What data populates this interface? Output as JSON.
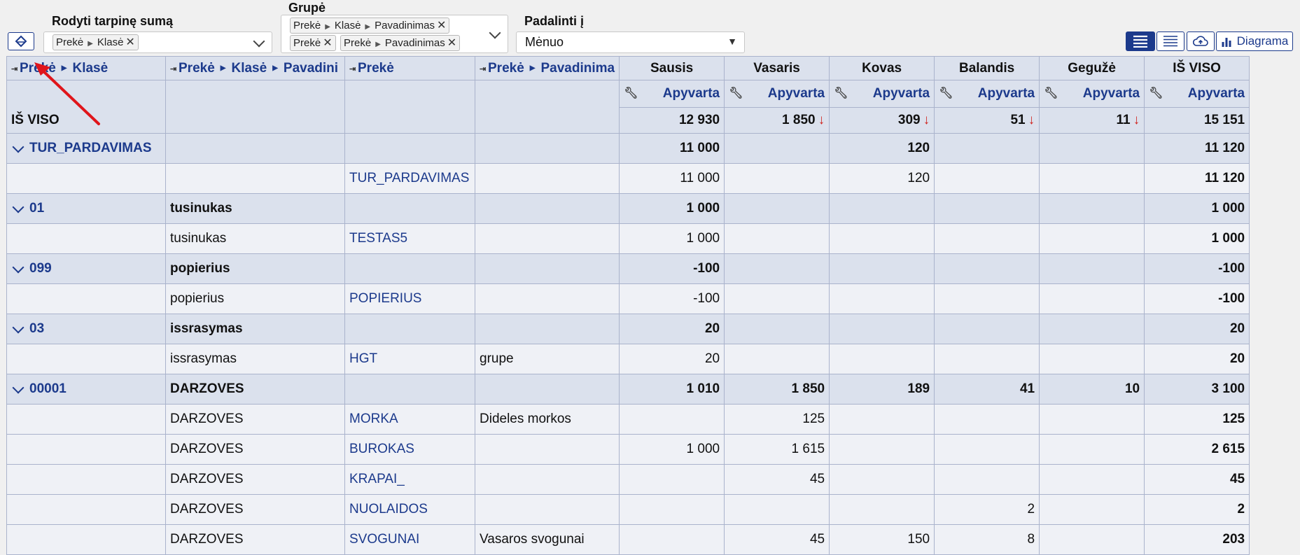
{
  "controls": {
    "subtotal_label": "Rodyti tarpinę sumą",
    "subtotal_chip": [
      "Prekė",
      "Klasė"
    ],
    "group_label": "Grupė",
    "group_chip1": [
      "Prekė",
      "Klasė",
      "Pavadinimas"
    ],
    "group_chip2": "Prekė",
    "group_chip3": [
      "Prekė",
      "Pavadinimas"
    ],
    "split_label": "Padalinti į",
    "split_value": "Mėnuo",
    "diagram_button": "Diagrama"
  },
  "columns": {
    "dim1": [
      "Prekė",
      "Klasė"
    ],
    "dim2": [
      "Prekė",
      "Klasė",
      "Pavadini"
    ],
    "dim3": "Prekė",
    "dim4": [
      "Prekė",
      "Pavadinima"
    ],
    "months": [
      "Sausis",
      "Vasaris",
      "Kovas",
      "Balandis",
      "Gegužė",
      "IŠ VISO"
    ],
    "measure": "Apyvarta"
  },
  "totals": {
    "label": "IŠ VISO",
    "values": [
      "12 930",
      "1 850",
      "309",
      "51",
      "11",
      "15 151"
    ],
    "down_arrow": "↓"
  },
  "rows": [
    {
      "type": "group",
      "c1": "TUR_PARDAVIMAS",
      "c2": "",
      "c3": "",
      "c4": "",
      "v": [
        "11 000",
        "",
        "120",
        "",
        "",
        "11 120"
      ]
    },
    {
      "type": "detail",
      "c1": "",
      "c2": "",
      "c3": "TUR_PARDAVIMAS",
      "c4": "",
      "v": [
        "11 000",
        "",
        "120",
        "",
        "",
        "11 120"
      ]
    },
    {
      "type": "group",
      "c1": "01",
      "c2": "tusinukas",
      "c3": "",
      "c4": "",
      "v": [
        "1 000",
        "",
        "",
        "",
        "",
        "1 000"
      ]
    },
    {
      "type": "detail",
      "c1": "",
      "c2": "tusinukas",
      "c3": "TESTAS5",
      "c4": "",
      "v": [
        "1 000",
        "",
        "",
        "",
        "",
        "1 000"
      ]
    },
    {
      "type": "group",
      "c1": "099",
      "c2": "popierius",
      "c3": "",
      "c4": "",
      "v": [
        "-100",
        "",
        "",
        "",
        "",
        "-100"
      ]
    },
    {
      "type": "detail",
      "c1": "",
      "c2": "popierius",
      "c3": "POPIERIUS",
      "c4": "",
      "v": [
        "-100",
        "",
        "",
        "",
        "",
        "-100"
      ]
    },
    {
      "type": "group",
      "c1": "03",
      "c2": "issrasymas",
      "c3": "",
      "c4": "",
      "v": [
        "20",
        "",
        "",
        "",
        "",
        "20"
      ]
    },
    {
      "type": "detail",
      "c1": "",
      "c2": "issrasymas",
      "c3": "HGT",
      "c4": "grupe",
      "v": [
        "20",
        "",
        "",
        "",
        "",
        "20"
      ]
    },
    {
      "type": "group",
      "c1": "00001",
      "c2": "DARZOVES",
      "c3": "",
      "c4": "",
      "v": [
        "1 010",
        "1 850",
        "189",
        "41",
        "10",
        "3 100"
      ]
    },
    {
      "type": "detail",
      "c1": "",
      "c2": "DARZOVES",
      "c3": "MORKA",
      "c4": "Dideles morkos",
      "v": [
        "",
        "125",
        "",
        "",
        "",
        "125"
      ]
    },
    {
      "type": "detail",
      "c1": "",
      "c2": "DARZOVES",
      "c3": "BUROKAS",
      "c4": "",
      "v": [
        "1 000",
        "1 615",
        "",
        "",
        "",
        "2 615"
      ]
    },
    {
      "type": "detail",
      "c1": "",
      "c2": "DARZOVES",
      "c3": "KRAPAI_",
      "c4": "",
      "v": [
        "",
        "45",
        "",
        "",
        "",
        "45"
      ]
    },
    {
      "type": "detail",
      "c1": "",
      "c2": "DARZOVES",
      "c3": "NUOLAIDOS",
      "c4": "",
      "v": [
        "",
        "",
        "",
        "2",
        "",
        "2"
      ]
    },
    {
      "type": "detail",
      "c1": "",
      "c2": "DARZOVES",
      "c3": "SVOGUNAI",
      "c4": "Vasaros svogunai",
      "v": [
        "",
        "45",
        "150",
        "8",
        "",
        "203"
      ]
    }
  ]
}
